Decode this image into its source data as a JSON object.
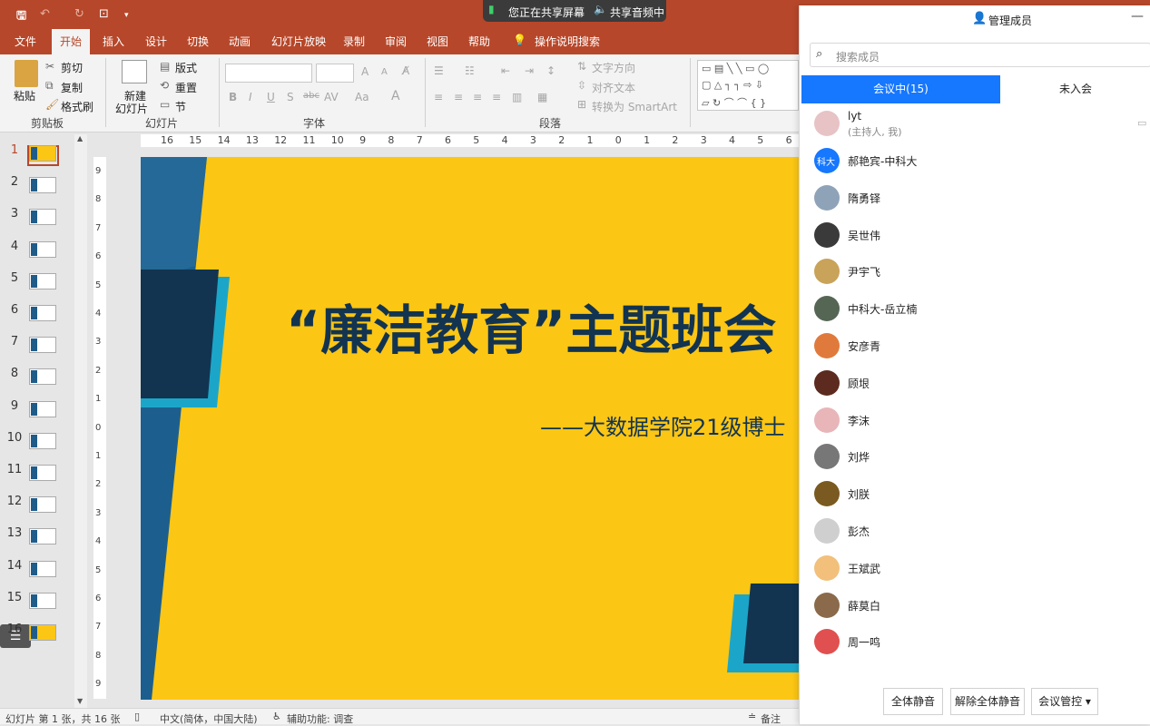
{
  "quick_access": {
    "autosave_icon": "save-icon"
  },
  "share_banner": {
    "screen": "您正在共享屏幕",
    "audio": "共享音频中"
  },
  "ribbon_tabs": [
    "文件",
    "开始",
    "插入",
    "设计",
    "切换",
    "动画",
    "幻灯片放映",
    "录制",
    "审阅",
    "视图",
    "帮助"
  ],
  "tell_me": "操作说明搜索",
  "clipboard": {
    "paste": "粘贴",
    "cut": "剪切",
    "copy": "复制",
    "format_painter": "格式刷",
    "group": "剪贴板"
  },
  "slides_group": {
    "new_slide_1": "新建",
    "new_slide_2": "幻灯片",
    "layout": "版式",
    "reset": "重置",
    "section": "节",
    "group": "幻灯片"
  },
  "font_group": {
    "group": "字体",
    "bold": "B",
    "italic": "I",
    "underline": "U",
    "shadow": "S",
    "strike": "abc",
    "spacing": "AV",
    "case": "Aa",
    "color": "A",
    "grow": "A",
    "shrink": "A"
  },
  "paragraph_group": {
    "group": "段落",
    "text_direction": "文字方向",
    "align_text": "对齐文本",
    "smartart": "转换为 SmartArt"
  },
  "ruler_h": [
    "16",
    "15",
    "14",
    "13",
    "12",
    "11",
    "10",
    "9",
    "8",
    "7",
    "6",
    "5",
    "4",
    "3",
    "2",
    "1",
    "0",
    "1",
    "2",
    "3",
    "4",
    "5",
    "6"
  ],
  "ruler_v": [
    "9",
    "8",
    "7",
    "6",
    "5",
    "4",
    "3",
    "2",
    "1",
    "0",
    "1",
    "2",
    "3",
    "4",
    "5",
    "6",
    "7",
    "8",
    "9"
  ],
  "slide_numbers": [
    "1",
    "2",
    "3",
    "4",
    "5",
    "6",
    "7",
    "8",
    "9",
    "10",
    "11",
    "12",
    "13",
    "14",
    "15",
    "16"
  ],
  "slide": {
    "title": "“廉洁教育”主题班会",
    "subtitle": "——大数据学院21级博士"
  },
  "status": {
    "slide_info": "幻灯片 第 1 张，共 16 张",
    "language": "中文(简体，中国大陆)",
    "accessibility": "辅助功能: 调查",
    "notes": "备注"
  },
  "panel": {
    "title": "管理成员",
    "search_placeholder": "搜索成员",
    "tab_in": "会议中(15)",
    "tab_out": "未入会",
    "host_name": "lyt",
    "host_role": "(主持人, 我)",
    "members": [
      {
        "name": "郝艳宾-中科大",
        "avatar": "#1677ff",
        "text": "科大"
      },
      {
        "name": "隋勇铎",
        "avatar": "#8fa3b8",
        "text": ""
      },
      {
        "name": "吴世伟",
        "avatar": "#3a3a3a",
        "text": ""
      },
      {
        "name": "尹宇飞",
        "avatar": "#c9a35a",
        "text": ""
      },
      {
        "name": "中科大-岳立楠",
        "avatar": "#556655",
        "text": ""
      },
      {
        "name": "安彦青",
        "avatar": "#e07a3c",
        "text": ""
      },
      {
        "name": "顾垠",
        "avatar": "#5c2a1f",
        "text": ""
      },
      {
        "name": "李沫",
        "avatar": "#e8b5b8",
        "text": ""
      },
      {
        "name": "刘烨",
        "avatar": "#777777",
        "text": ""
      },
      {
        "name": "刘朕",
        "avatar": "#7a5a20",
        "text": ""
      },
      {
        "name": "彭杰",
        "avatar": "#cfcfcf",
        "text": ""
      },
      {
        "name": "王斌武",
        "avatar": "#f2c07a",
        "text": ""
      },
      {
        "name": "薛莫白",
        "avatar": "#8a6a4a",
        "text": ""
      },
      {
        "name": "周一鸣",
        "avatar": "#e05050",
        "text": ""
      }
    ],
    "mute_all": "全体静音",
    "unmute_all": "解除全体静音",
    "control": "会议管控"
  },
  "colors": {
    "ppt_red": "#b7472a",
    "slide_yellow": "#fcc614",
    "navy": "#123450",
    "cyan": "#1ba6c9",
    "tencent_blue": "#1677ff"
  }
}
